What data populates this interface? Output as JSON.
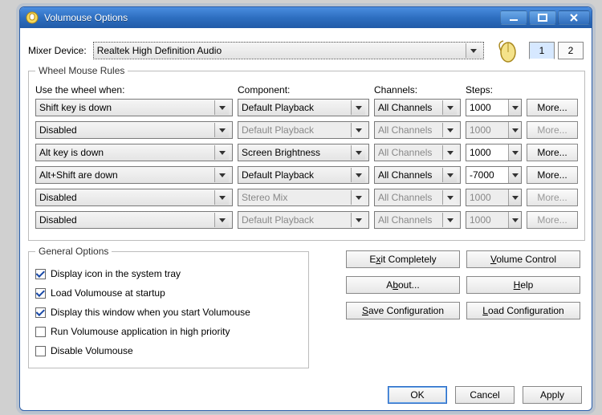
{
  "window": {
    "title": "Volumouse Options"
  },
  "mixer": {
    "label": "Mixer Device:",
    "value": "Realtek High Definition Audio"
  },
  "tabs": {
    "one": "1",
    "two": "2"
  },
  "rules": {
    "legend": "Wheel Mouse Rules",
    "headers": {
      "usewhen": "Use the wheel when:",
      "component": "Component:",
      "channels": "Channels:",
      "steps": "Steps:"
    },
    "rows": [
      {
        "usewhen": "Shift key is down",
        "component": "Default Playback",
        "channels": "All Channels",
        "steps": "1000",
        "more": "More...",
        "disabled": false,
        "comp_disabled": false,
        "chan_disabled": false,
        "steps_disabled": false
      },
      {
        "usewhen": "Disabled",
        "component": "Default Playback",
        "channels": "All Channels",
        "steps": "1000",
        "more": "More...",
        "disabled": true,
        "comp_disabled": true,
        "chan_disabled": true,
        "steps_disabled": true
      },
      {
        "usewhen": "Alt key is down",
        "component": "Screen Brightness",
        "channels": "All Channels",
        "steps": "1000",
        "more": "More...",
        "disabled": false,
        "comp_disabled": false,
        "chan_disabled": true,
        "steps_disabled": false
      },
      {
        "usewhen": "Alt+Shift are down",
        "component": "Default Playback",
        "channels": "All Channels",
        "steps": "-7000",
        "more": "More...",
        "disabled": false,
        "comp_disabled": false,
        "chan_disabled": false,
        "steps_disabled": false
      },
      {
        "usewhen": "Disabled",
        "component": "Stereo Mix",
        "channels": "All Channels",
        "steps": "1000",
        "more": "More...",
        "disabled": true,
        "comp_disabled": true,
        "chan_disabled": true,
        "steps_disabled": true
      },
      {
        "usewhen": "Disabled",
        "component": "Default Playback",
        "channels": "All Channels",
        "steps": "1000",
        "more": "More...",
        "disabled": true,
        "comp_disabled": true,
        "chan_disabled": true,
        "steps_disabled": true
      }
    ]
  },
  "general": {
    "legend": "General Options",
    "items": [
      {
        "label": "Display icon in the system tray",
        "checked": true
      },
      {
        "label": "Load Volumouse at startup",
        "checked": true
      },
      {
        "label": "Display this window when you start Volumouse",
        "checked": true
      },
      {
        "label": "Run Volumouse application in high priority",
        "checked": false
      },
      {
        "label": "Disable Volumouse",
        "checked": false
      }
    ]
  },
  "buttons_right": {
    "exit": "Exit Completely",
    "exit_u": "x",
    "volume": "Volume Control",
    "volume_u": "V",
    "about": "About...",
    "about_u": "b",
    "help": "Help",
    "help_u": "H",
    "save": "Save Configuration",
    "save_u": "S",
    "load": "Load Configuration",
    "load_u": "L"
  },
  "footer": {
    "ok": "OK",
    "cancel": "Cancel",
    "apply": "Apply"
  }
}
